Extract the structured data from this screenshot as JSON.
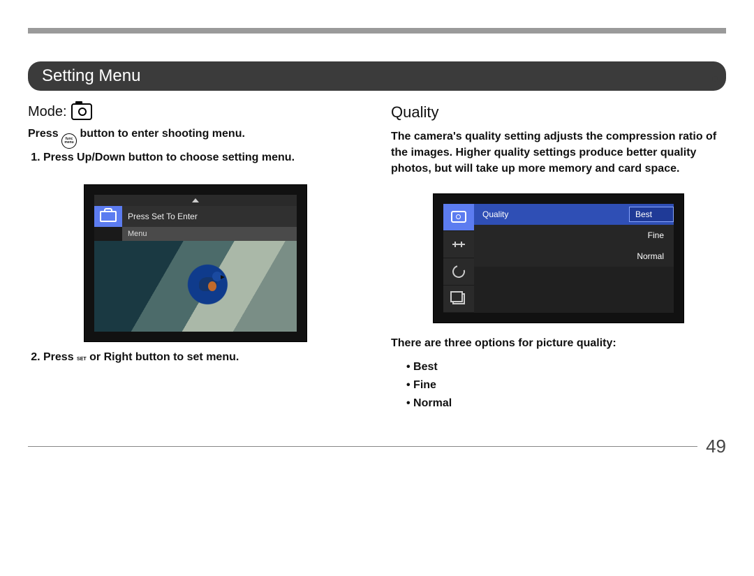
{
  "page": {
    "title": "Setting Menu",
    "number": "49"
  },
  "left": {
    "mode_label": "Mode:",
    "intro_pre": "Press",
    "intro_btn": "func menu",
    "intro_post": "button to enter shooting menu.",
    "step1": "Press Up/Down button to choose setting menu.",
    "step2_pre": "Press",
    "step2_btn": "SET",
    "step2_post": "or Right button to set menu.",
    "shot": {
      "row1": "Press Set To Enter",
      "row2": "Menu"
    }
  },
  "right": {
    "heading": "Quality",
    "para": "The camera's quality setting adjusts the compression ratio of the images. Higher quality settings produce better quality photos, but will take up more memory and card space.",
    "shot": {
      "label": "Quality",
      "sel": "Best",
      "opt2": "Fine",
      "opt3": "Normal"
    },
    "options_intro": "There are three options for picture quality:",
    "options": {
      "o1": "Best",
      "o2": "Fine",
      "o3": "Normal"
    }
  }
}
